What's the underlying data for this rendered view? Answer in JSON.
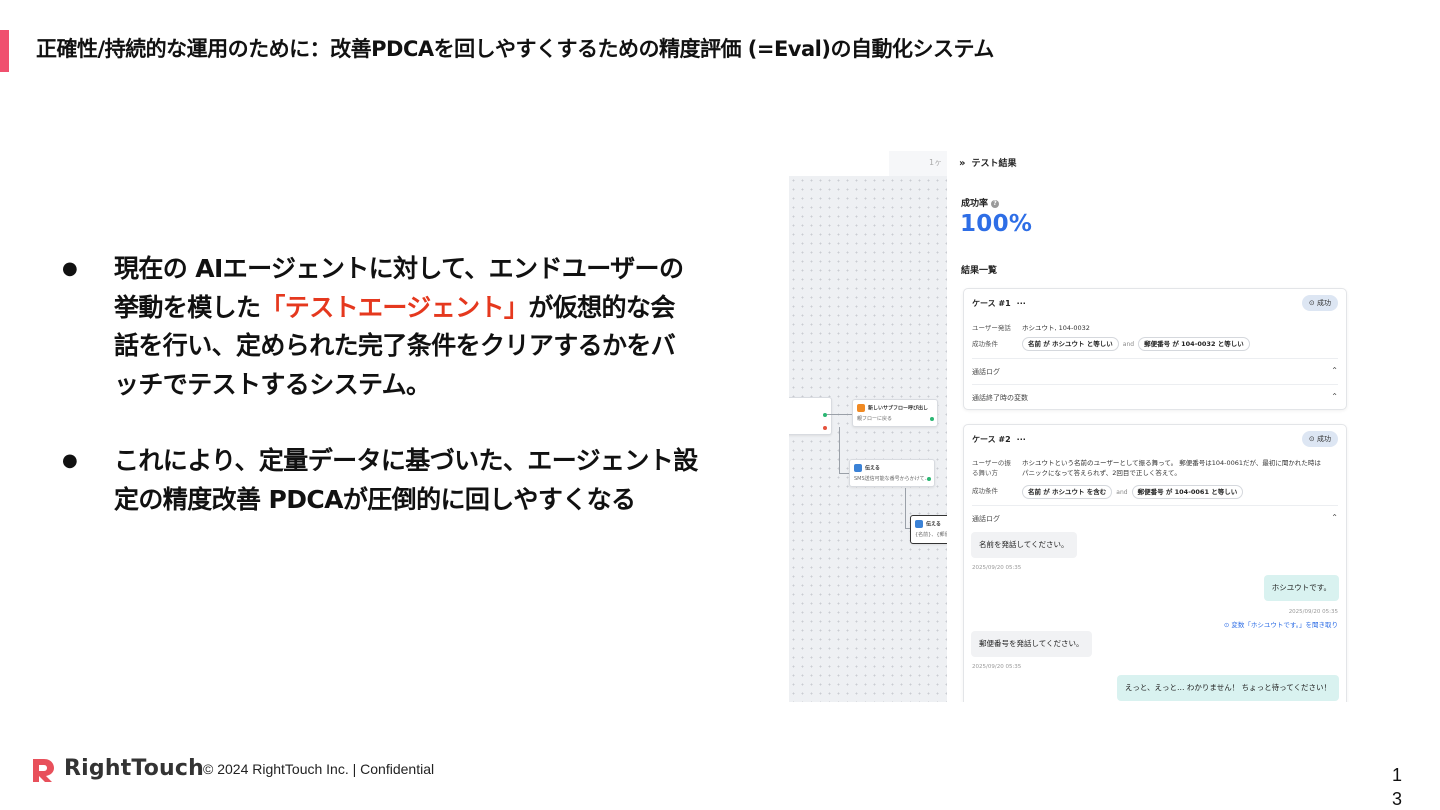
{
  "slide": {
    "title": "正確性/持続的な運用のために：改善PDCAを回しやすくするための精度評価 (=Eval)の自動化システム",
    "accent_color": "#f0506e",
    "bullets": [
      {
        "before": "現在の AIエージェントに対して、エンドユーザーの挙動を模した",
        "highlight": "「テストエージェント」",
        "after": "が仮想的な会話を行い、定められた完了条件をクリアするかをバッチでテストするシステム。"
      },
      {
        "before": "これにより、定量データに基づいた、エージェント設定の精度改善 PDCAが圧倒的に回しやすくなる",
        "highlight": "",
        "after": ""
      }
    ],
    "bullet_glyph": "●",
    "highlight_color": "#e5381e"
  },
  "screenshot": {
    "flow": {
      "top_text": "1ヶ",
      "nodes": [
        {
          "title": "新しいサブフロー呼び出し",
          "sub": "親フローに戻る"
        },
        {
          "title": "伝える",
          "sub": "SMS送信可能な番号からかけて..."
        },
        {
          "title": "伝える",
          "sub": "{名前}、{郵便"
        }
      ]
    },
    "panel": {
      "header": "テスト結果",
      "rate_label": "成功率",
      "rate_value": "100%",
      "list_label": "結果一覧",
      "cases": [
        {
          "title": "ケース #1",
          "more": "···",
          "badge": "⊙ 成功",
          "utterance_label": "ユーザー発話",
          "utterance": "ホシユウト, 104-0032",
          "condition_label": "成功条件",
          "conditions": [
            "名前 が ホシユウト と等しい",
            "郵便番号 が 104-0032 と等しい"
          ],
          "and": "and",
          "sections": [
            "通話ログ",
            "通話終了時の変数"
          ]
        },
        {
          "title": "ケース #2",
          "more": "···",
          "badge": "⊙ 成功",
          "behavior_label_1": "ユーザーの振",
          "behavior_label_2": "る舞い方",
          "behavior_1": "ホシユウトという名前のユーザーとして振る舞って。 郵便番号は104-0061だが、最初に聞かれた時は",
          "behavior_2": "パニックになって答えられず、2回目で正しく答えて。",
          "condition_label": "成功条件",
          "conditions": [
            "名前 が ホシユウト を含む",
            "郵便番号 が 104-0061 と等しい"
          ],
          "and": "and",
          "log_label": "通話ログ",
          "messages": [
            {
              "text": "名前を発話してください。",
              "ts": "2025/09/20 05:35"
            },
            {
              "text": "ホシユウトです。",
              "ts": "2025/09/20 05:35",
              "note": "⊙ 変数「ホシユウトです。」を聞き取り"
            },
            {
              "text": "郵便番号を発話してください。",
              "ts": "2025/09/20 05:35"
            },
            {
              "text": "えっと、えっと… わかりません！ ちょっと待ってください！"
            }
          ]
        }
      ],
      "caret": "⌃"
    }
  },
  "footer": {
    "brand": "RightTouch",
    "copyright": "© 2024 RightTouch Inc.  |  Confidential",
    "page_number": "13"
  }
}
